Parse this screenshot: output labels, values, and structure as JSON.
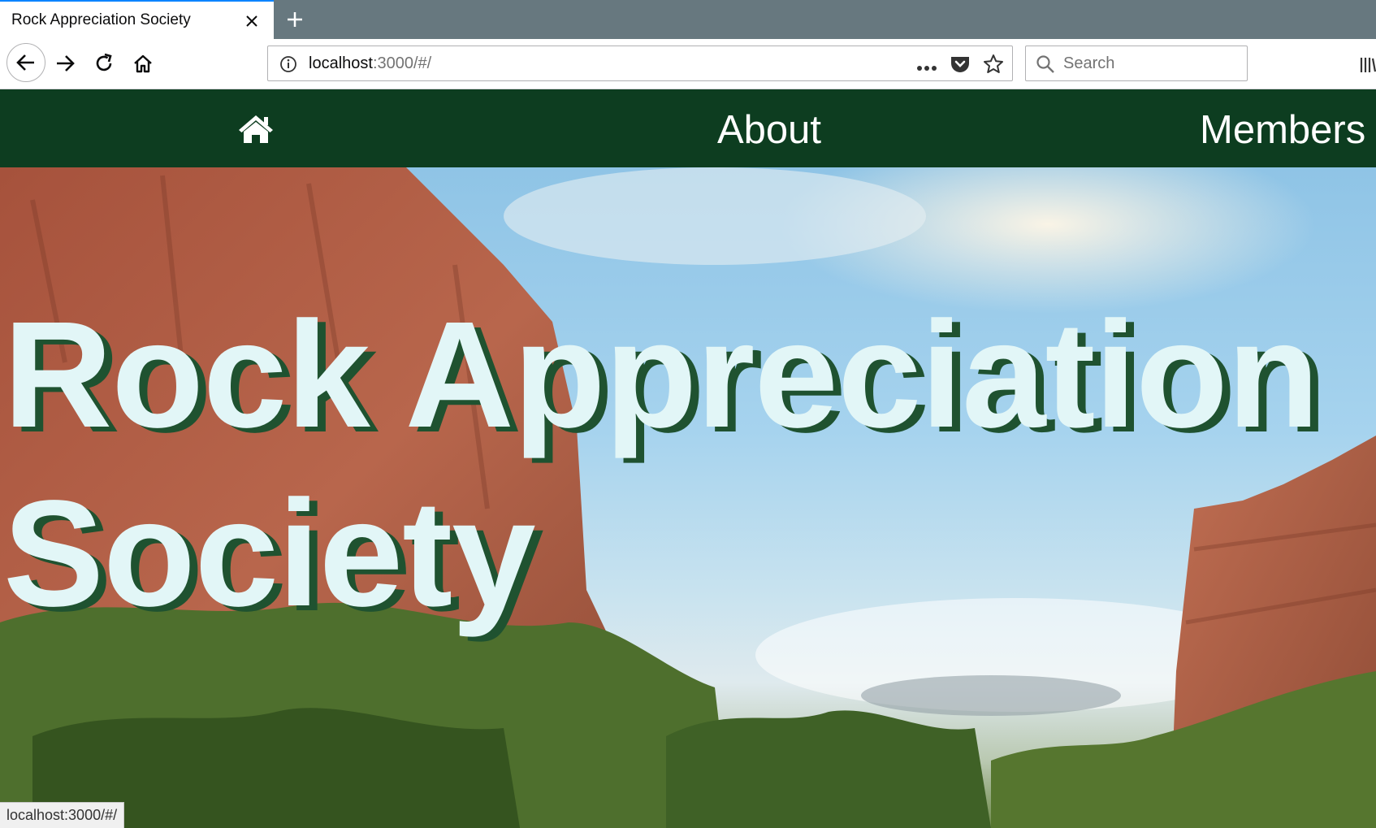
{
  "browser": {
    "tab": {
      "title": "Rock Appreciation Society"
    },
    "url": {
      "host": "localhost",
      "path": ":3000/#/"
    },
    "search": {
      "placeholder": "Search"
    },
    "status": "localhost:3000/#/"
  },
  "site": {
    "nav": {
      "about": "About",
      "members": "Members"
    },
    "hero": {
      "title": "Rock Appreciation Society"
    }
  },
  "colors": {
    "navbar": "#0d3d20",
    "title_fill": "#e2f6f7",
    "title_shadow": "#1f5230",
    "tab_accent": "#0a84ff"
  }
}
